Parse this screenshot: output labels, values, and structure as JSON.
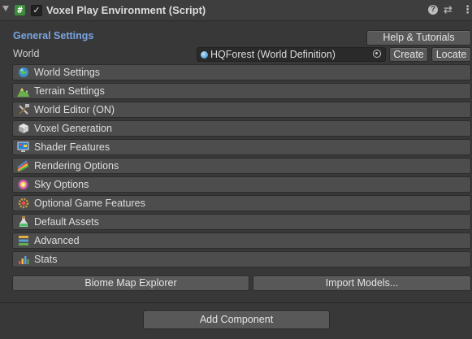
{
  "header": {
    "title": "Voxel Play Environment (Script)",
    "script_icon_glyph": "#",
    "enabled_check": "✓",
    "help_glyph": "?",
    "preset_glyph": "⇄",
    "menu_glyph": "⋮"
  },
  "general": {
    "title": "General Settings",
    "help_button": "Help & Tutorials",
    "world_label": "World",
    "world_value": "HQForest (World Definition)",
    "create_button": "Create",
    "locate_button": "Locate"
  },
  "sections": [
    {
      "label": "World Settings",
      "icon": "globe-icon"
    },
    {
      "label": "Terrain Settings",
      "icon": "mountain-icon"
    },
    {
      "label": "World Editor (ON)",
      "icon": "tools-icon"
    },
    {
      "label": "Voxel Generation",
      "icon": "cube-icon"
    },
    {
      "label": "Shader Features",
      "icon": "monitor-icon"
    },
    {
      "label": "Rendering Options",
      "icon": "paint-icon"
    },
    {
      "label": "Sky Options",
      "icon": "sky-icon"
    },
    {
      "label": "Optional Game Features",
      "icon": "gear-icon"
    },
    {
      "label": "Default Assets",
      "icon": "potion-icon"
    },
    {
      "label": "Advanced",
      "icon": "layers-icon"
    },
    {
      "label": "Stats",
      "icon": "bar-chart-icon"
    }
  ],
  "footer": {
    "biome_button": "Biome Map Explorer",
    "import_button": "Import Models...",
    "add_component_button": "Add Component"
  },
  "colors": {
    "background": "#383838",
    "section_bg": "#4d4d4d",
    "accent_title": "#7ba4e0"
  }
}
